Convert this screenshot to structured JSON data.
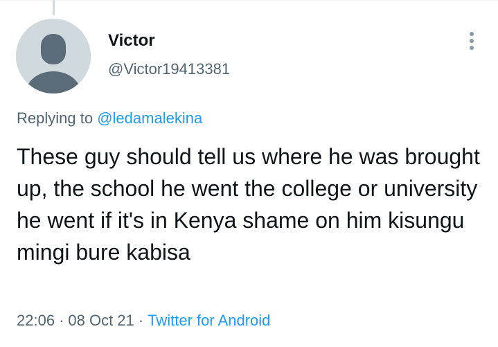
{
  "tweet": {
    "author": {
      "display_name": "Victor",
      "handle": "@Victor19413381",
      "avatar_icon": "default-profile-icon"
    },
    "reply_context": {
      "prefix": "Replying to",
      "mention": "@ledamalekina"
    },
    "text": "These guy should tell us where he was brought up, the school he went the college or university he went if it's in Kenya shame on him kisungu mingi bure kabisa",
    "time": "22:06",
    "date": "08 Oct 21",
    "separator": "·",
    "source": "Twitter for Android",
    "more_icon": "more-vertical-icon"
  },
  "colors": {
    "text_primary": "#0f1419",
    "text_secondary": "#536471",
    "accent": "#1d9bf0",
    "avatar_bg": "#cfd9de",
    "avatar_figure": "#5b6b78"
  }
}
